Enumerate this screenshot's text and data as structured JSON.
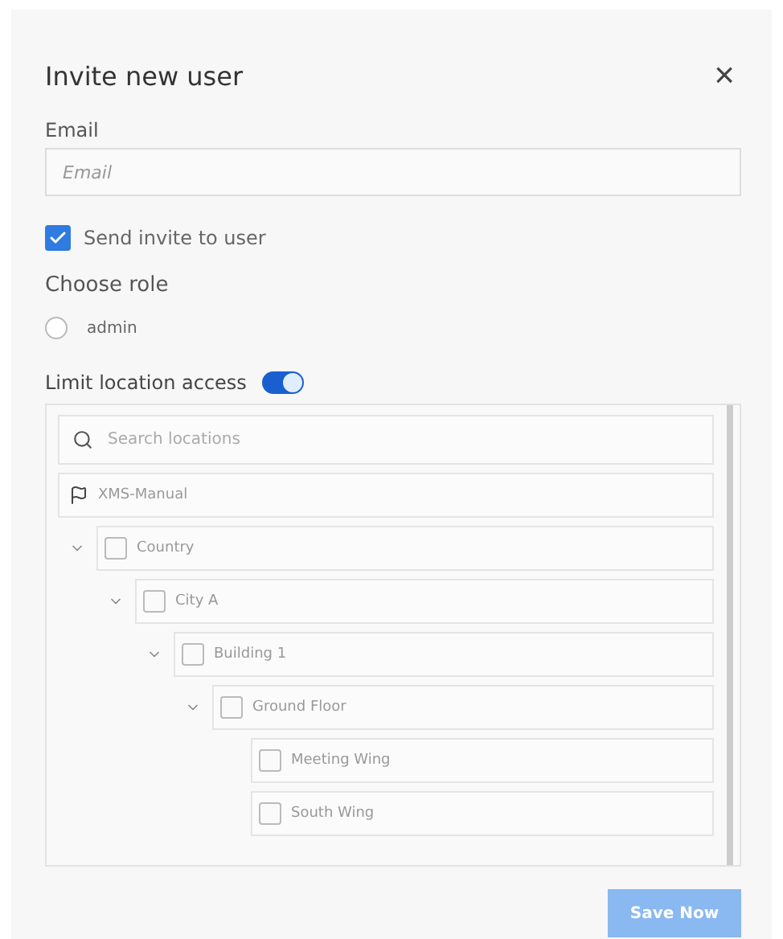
{
  "dialog": {
    "title": "Invite new user",
    "close": "×"
  },
  "email": {
    "label": "Email",
    "placeholder": "Email"
  },
  "send_invite": {
    "label": "Send invite to user",
    "checked": true
  },
  "role": {
    "label": "Choose role",
    "options": [
      {
        "label": "admin",
        "selected": false
      }
    ]
  },
  "limit_location": {
    "label": "Limit location access",
    "on": true
  },
  "locations": {
    "search_placeholder": "Search locations",
    "root": "XMS-Manual",
    "tree": [
      {
        "label": "Country",
        "checked": false,
        "expanded": true,
        "children": [
          {
            "label": "City A",
            "checked": false,
            "expanded": true,
            "children": [
              {
                "label": "Building 1",
                "checked": false,
                "expanded": true,
                "children": [
                  {
                    "label": "Ground Floor",
                    "checked": false,
                    "expanded": true,
                    "children": [
                      {
                        "label": "Meeting Wing",
                        "checked": false
                      },
                      {
                        "label": "South Wing",
                        "checked": false
                      }
                    ]
                  }
                ]
              }
            ]
          }
        ]
      }
    ]
  },
  "save_button": {
    "label": "Save Now",
    "disabled": true
  }
}
